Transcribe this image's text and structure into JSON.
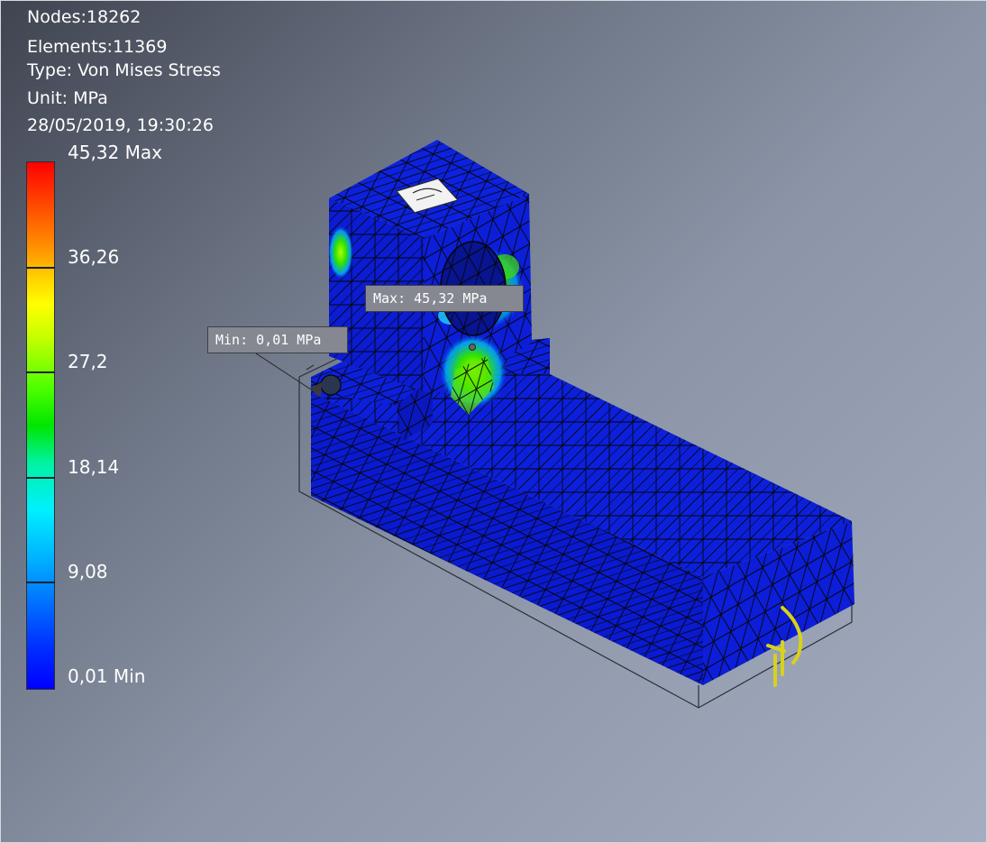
{
  "info": {
    "nodes": "Nodes:18262",
    "elements": "Elements:11369",
    "type": "Type: Von Mises Stress",
    "unit": "Unit: MPa",
    "timestamp": "28/05/2019, 19:30:26"
  },
  "legend": {
    "labels": [
      "45,32 Max",
      "36,26",
      "27,2",
      "18,14",
      "9,08",
      "0,01 Min"
    ],
    "max_value": 45.32,
    "min_value": 0.01
  },
  "probes": {
    "max_label": "Max: 45,32 MPa",
    "min_label": "Min: 0,01 MPa"
  },
  "colors": {
    "mesh_blue": "#0c1fd6",
    "mesh_blue_dark": "#0a17a8",
    "mesh_line": "#0a0a0a",
    "stress_green": "#40e000",
    "stress_cyan": "#20e0ff",
    "load_arrow": "#d8d21a",
    "probe_bg": "#858891"
  }
}
